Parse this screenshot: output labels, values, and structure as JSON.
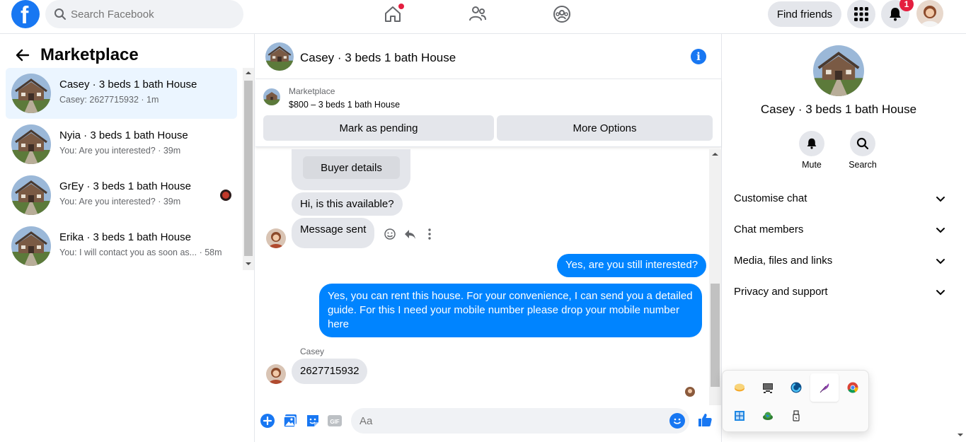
{
  "topbar": {
    "logo": "facebook-logo",
    "search_placeholder": "Search Facebook",
    "find_friends_label": "Find friends",
    "notifications_count": "1",
    "accent_color": "#1877f2"
  },
  "left": {
    "title": "Marketplace",
    "conversations": [
      {
        "name": "Casey · 3 beds 1 bath House",
        "preview": "Casey: 2627715932 · 1m",
        "active": true
      },
      {
        "name": "Nyia · 3 beds 1 bath House",
        "preview": "You: Are you interested? · 39m",
        "active": false
      },
      {
        "name": "GrEy · 3 beds 1 bath House",
        "preview": "You: Are you interested? · 39m",
        "active": false
      },
      {
        "name": "Erika · 3 beds 1 bath House",
        "preview": "You: I will contact you as soon as... · 58m",
        "active": false
      }
    ]
  },
  "chat": {
    "title": "Casey · 3 beds 1 bath House",
    "marketplace_label": "Marketplace",
    "listing": "$800 – 3 beds 1 bath House",
    "mark_pending_label": "Mark as pending",
    "more_options_label": "More Options",
    "buyer_details_label": "Buyer details",
    "messages": {
      "m1": "Hi, is this available?",
      "m2": "Message sent",
      "m3": "Yes, are you still interested?",
      "m4": "Yes, you can rent this house. For your convenience, I can send you a detailed guide. For this I need your mobile number please drop your mobile number here",
      "m5_sender": "Casey",
      "m5": "2627715932"
    },
    "composer_placeholder": "Aa"
  },
  "right": {
    "name": "Casey · 3 beds 1 bath House",
    "mute_label": "Mute",
    "search_label": "Search",
    "sections": [
      "Customise chat",
      "Chat members",
      "Media, files and links",
      "Privacy and support"
    ]
  },
  "tray": {
    "icons": [
      "tray-app-1-icon",
      "tray-display-icon",
      "tray-c-icon",
      "tray-feather-icon",
      "tray-chrome-icon",
      "tray-network-icon",
      "tray-globe-icon",
      "tray-usb-icon"
    ]
  }
}
